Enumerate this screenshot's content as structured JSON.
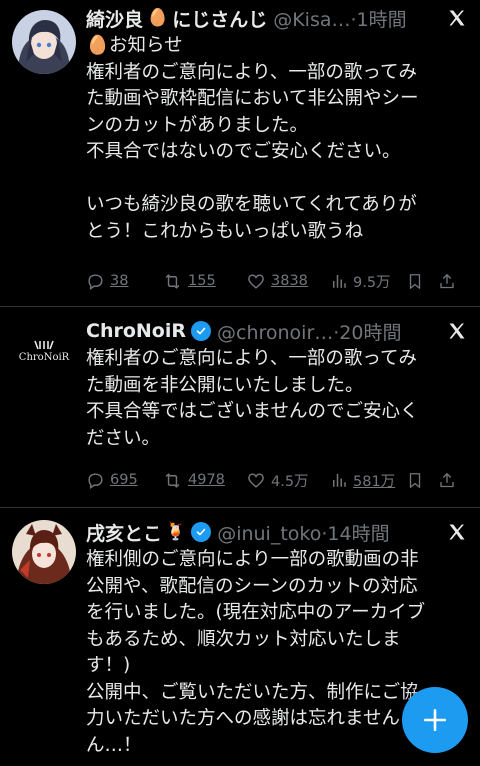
{
  "tweets": [
    {
      "display_name": "綺沙良",
      "emoji": "🥚",
      "name_suffix": "にじさんじ",
      "handle_time": "@Kisa…·1時間",
      "lines": [
        "🥚お知らせ",
        "権利者のご意向により、一部の歌ってみ",
        "た動画や歌枠配信において非公開やシー",
        "ンのカットがありました。",
        "不具合ではないのでご安心ください。",
        "",
        "いつも綺沙良の歌を聴いてくれてありが",
        "とう！これからもいっぱい歌うね"
      ],
      "replies": "38",
      "retweets": "155",
      "likes": "3838",
      "views": "9.5万"
    },
    {
      "display_name": "ChroNoiR",
      "handle_time": "@chronoir…·20時間",
      "avatar_text": "ChroNoiR",
      "lines": [
        "権利者のご意向により、一部の歌ってみ",
        "た動画を非公開にいたしました。",
        "不具合等ではございませんのでご安心く",
        "ださい。"
      ],
      "replies": "695",
      "retweets": "4978",
      "likes": "4.5万",
      "views": "581万"
    },
    {
      "display_name": "戌亥とこ",
      "emoji": "🍹",
      "handle_time": "@inui_toko·14時間",
      "lines": [
        "権利側のご意向により一部の歌動画の非",
        "公開や、歌配信のシーンのカットの対応",
        "を行いました。(現在対応中のアーカイブ",
        "もあるため、順次カット対応いたしま",
        "す！)",
        "公開中、ご覧いただいた方、制作にご協",
        "力いただいた方への感謝は忘れません",
        "ん…！"
      ]
    }
  ],
  "colors": {
    "accent": "#1d9bf0",
    "muted": "#71767b",
    "text": "#e7e9ea",
    "border": "#2f3336"
  }
}
